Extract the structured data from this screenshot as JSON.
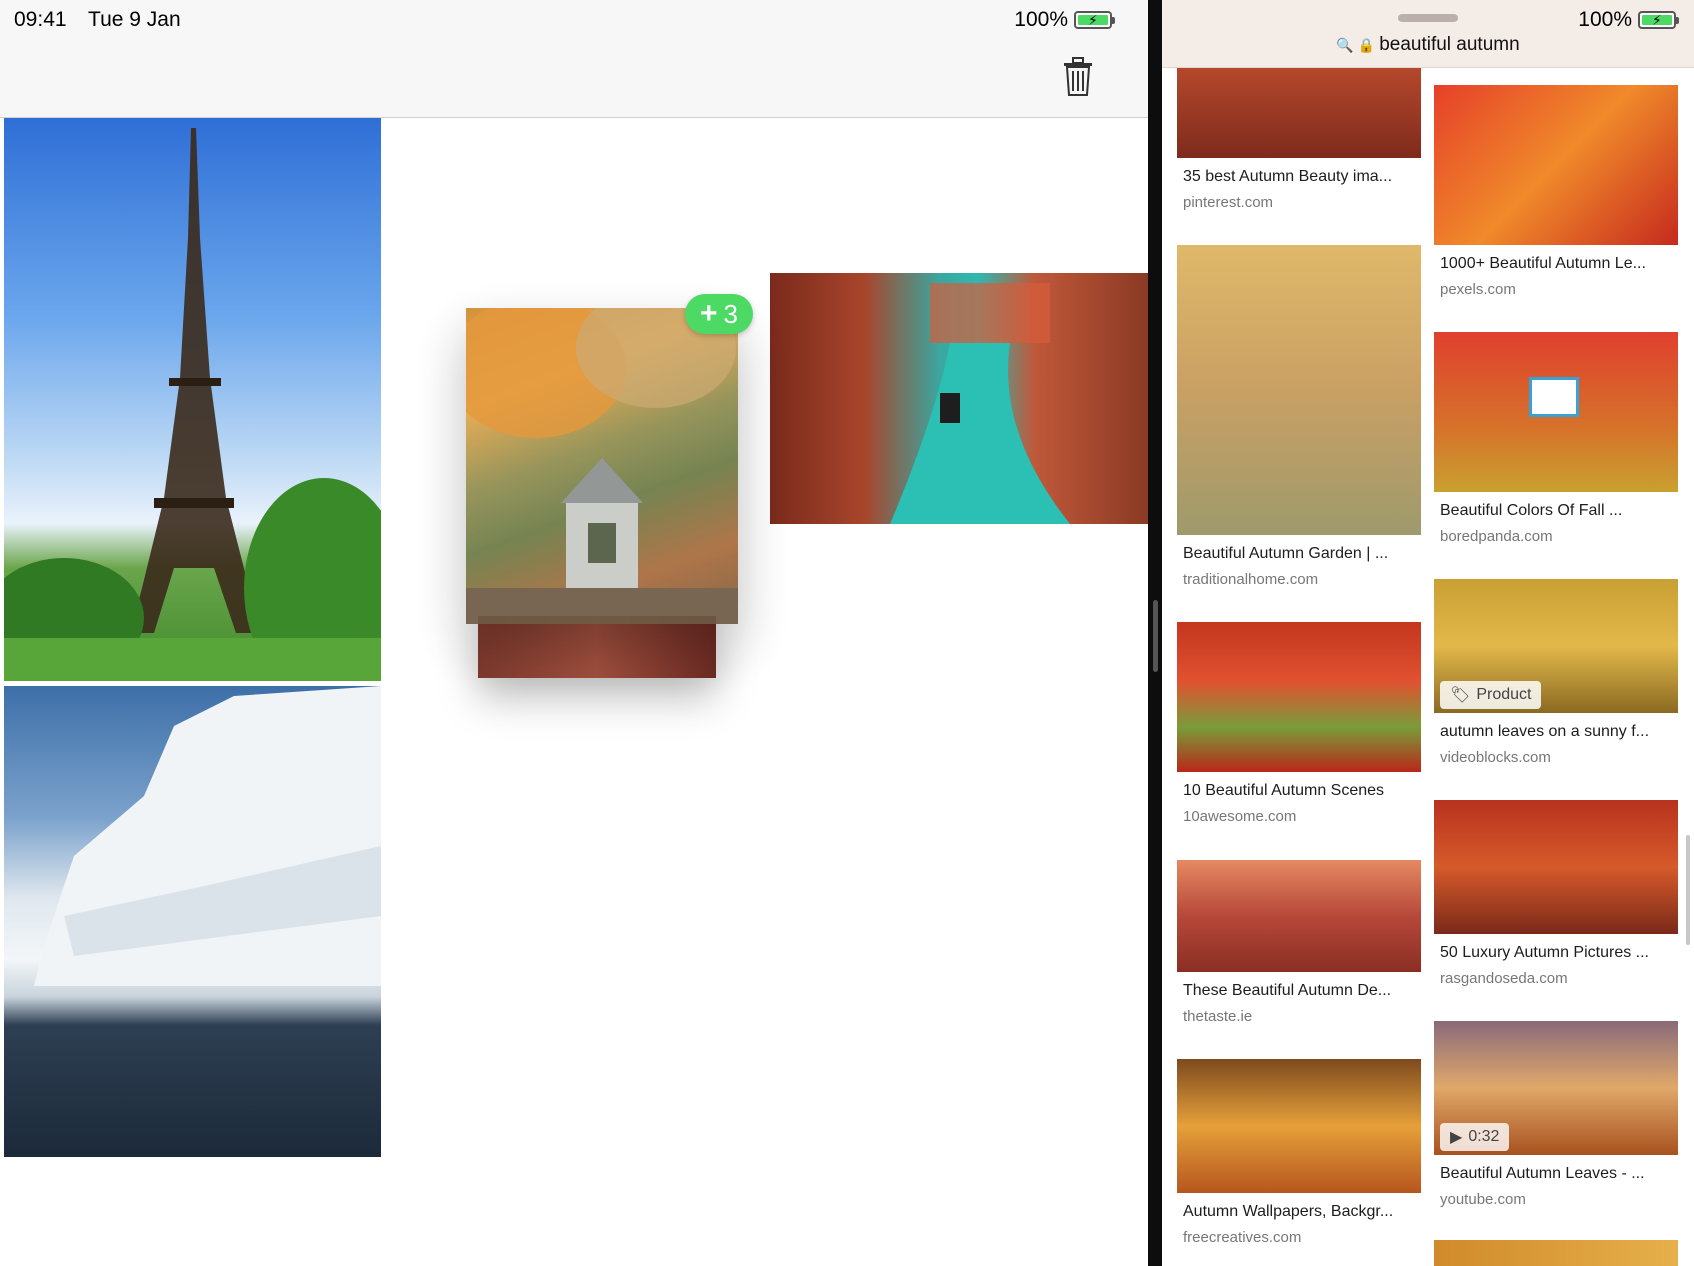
{
  "status": {
    "time": "09:41",
    "date": "Tue 9 Jan",
    "battery_left": "100%",
    "battery_right": "100%"
  },
  "left_app": {
    "drag_badge_count": "3",
    "photos": [
      "eiffel-tower",
      "iceberg",
      "venice-canal",
      "autumn-garden-house"
    ]
  },
  "safari": {
    "url_text": "beautiful autumn"
  },
  "results": {
    "left_col": [
      {
        "title": "35 best Autumn Beauty ima...",
        "source": "pinterest.com"
      },
      {
        "title": "Beautiful Autumn Garden | ...",
        "source": "traditionalhome.com"
      },
      {
        "title": "10 Beautiful Autumn Scenes",
        "source": "10awesome.com"
      },
      {
        "title": "These Beautiful Autumn De...",
        "source": "thetaste.ie"
      },
      {
        "title": "Autumn Wallpapers, Backgr...",
        "source": "freecreatives.com"
      }
    ],
    "right_col": [
      {
        "title": "1000+ Beautiful Autumn Le...",
        "source": "pexels.com"
      },
      {
        "title": "Beautiful Colors Of Fall ...",
        "source": "boredpanda.com"
      },
      {
        "title": "autumn leaves on a sunny f...",
        "source": "videoblocks.com",
        "chip": "Product"
      },
      {
        "title": "50 Luxury Autumn Pictures ...",
        "source": "rasgandoseda.com"
      },
      {
        "title": "Beautiful Autumn Leaves - ...",
        "source": "youtube.com",
        "chip": "0:32"
      }
    ]
  },
  "colors": {
    "badge_green": "#4cd964",
    "safari_bar": "#f4ece7"
  }
}
